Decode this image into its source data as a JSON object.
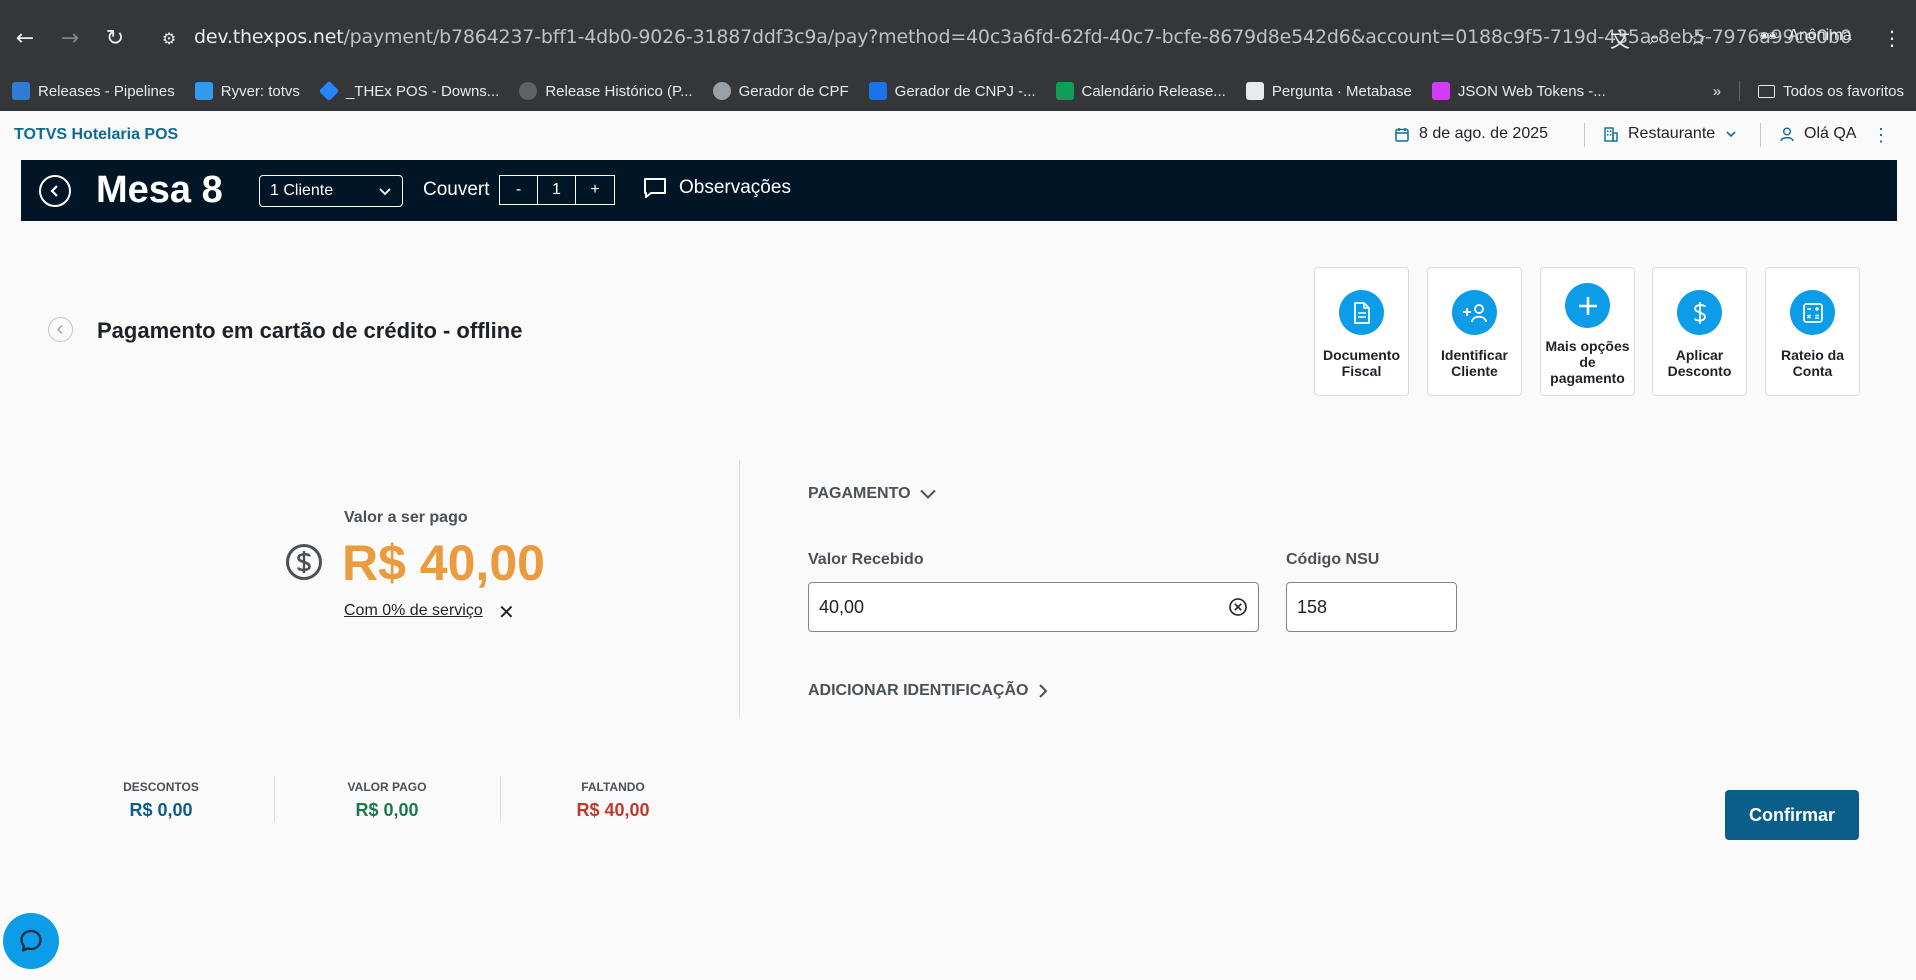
{
  "browser": {
    "url_host": "dev.thexpos.net",
    "url_path": "/payment/b7864237-bff1-4db0-9026-31887ddf3c9a/pay?method=40c3a6fd-62fd-40c7-bcfe-8679d8e542d6&account=0188c9f5-719d-435a-8eb5-7976a99ce0b0",
    "profile": "Anônima",
    "bookmarks": [
      {
        "label": "Releases - Pipelines",
        "color": "#2f7bd6"
      },
      {
        "label": "Ryver: totvs",
        "color": "#2e9bf0"
      },
      {
        "label": "_THEx POS - Downs...",
        "color": "#2684ff"
      },
      {
        "label": "Release Histórico (P...",
        "color": "#5f6368"
      },
      {
        "label": "Gerador de CPF",
        "color": "#9aa0a6"
      },
      {
        "label": "Gerador de CNPJ -...",
        "color": "#1a73e8"
      },
      {
        "label": "Calendário Release...",
        "color": "#0f9d58"
      },
      {
        "label": "Pergunta · Metabase",
        "color": "#e8eaed"
      },
      {
        "label": "JSON Web Tokens -...",
        "color": "#d63aff"
      }
    ],
    "all_bookmarks": "Todos os favoritos"
  },
  "header": {
    "brand": "TOTVS Hotelaria POS",
    "date": "8 de ago. de 2025",
    "location": "Restaurante",
    "user": "Olá QA"
  },
  "tablebar": {
    "title": "Mesa 8",
    "clients": "1 Cliente",
    "couvert_label": "Couvert",
    "couvert_minus": "-",
    "couvert_value": "1",
    "couvert_plus": "+",
    "observations": "Observações"
  },
  "page": {
    "title": "Pagamento em cartão de crédito - offline"
  },
  "actions": [
    {
      "label": "Documento Fiscal"
    },
    {
      "label": "Identificar Cliente"
    },
    {
      "label": "Mais opções de pagamento"
    },
    {
      "label": "Aplicar Desconto"
    },
    {
      "label": "Rateio da Conta"
    }
  ],
  "payment": {
    "amount_label": "Valor a ser pago",
    "amount": "R$ 40,00",
    "service": "Com 0% de serviço",
    "section": "PAGAMENTO",
    "received_label": "Valor Recebido",
    "received_value": "40,00",
    "nsu_label": "Código NSU",
    "nsu_value": "158",
    "add_identification": "ADICIONAR IDENTIFICAÇÃO"
  },
  "totals": {
    "discounts_label": "DESCONTOS",
    "discounts_value": "R$ 0,00",
    "paid_label": "VALOR PAGO",
    "paid_value": "R$ 0,00",
    "missing_label": "FALTANDO",
    "missing_value": "R$ 40,00"
  },
  "confirm": "Confirmar",
  "colors": {
    "accent": "#0c9ce8",
    "primary": "#0c5e8a",
    "amount": "#ea9b3e",
    "discount": "#0c5e8a",
    "paid": "#1a7a4c",
    "missing": "#c0392b"
  }
}
